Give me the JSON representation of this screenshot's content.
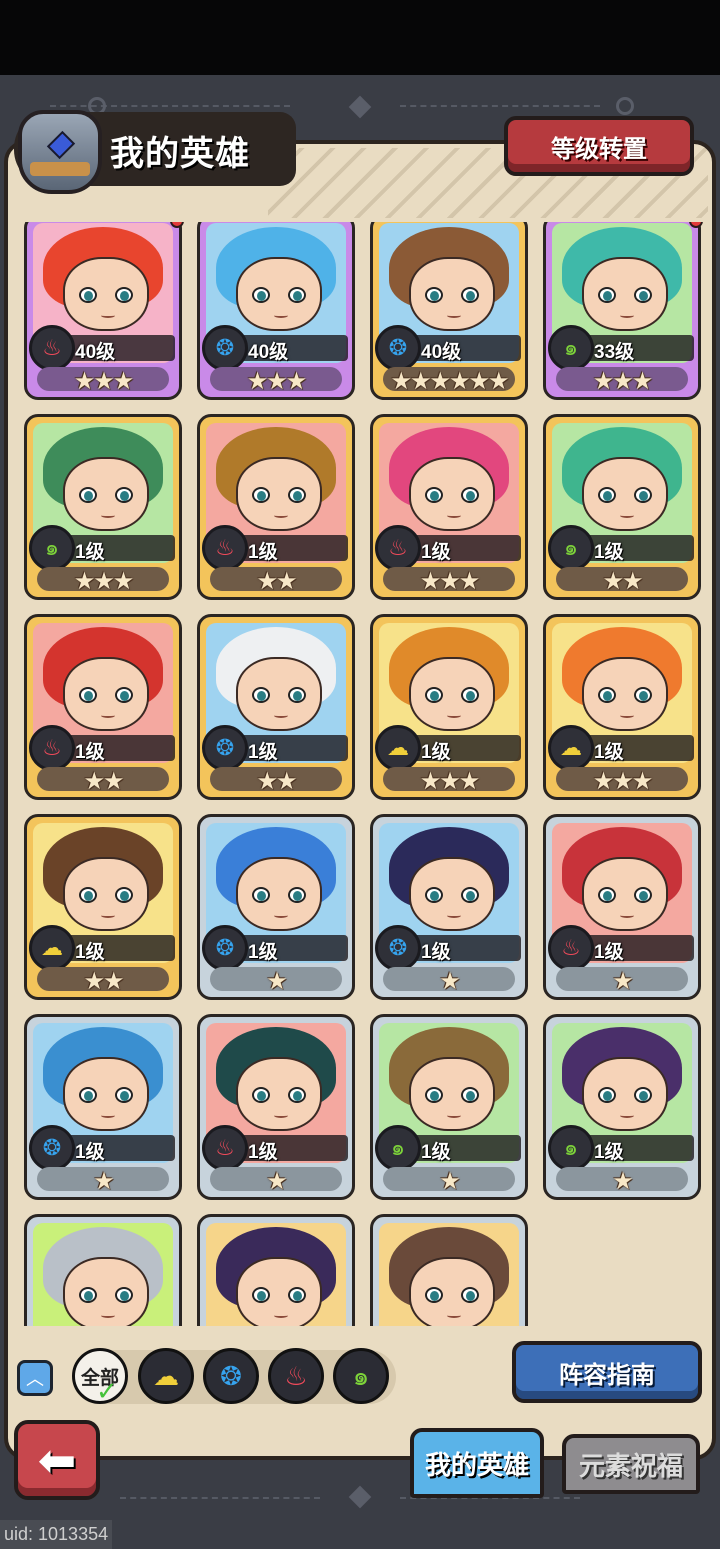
{
  "header": {
    "title": "我的英雄",
    "level_reset_button": "等级转置"
  },
  "heroes": [
    {
      "level": "40级",
      "stars": "★★★",
      "element": "fire",
      "frame": "purple",
      "hair": "#e8452e",
      "bg": "#f6b3c8",
      "badge": true
    },
    {
      "level": "40级",
      "stars": "★★★",
      "element": "water",
      "frame": "purple",
      "hair": "#4fb2e8",
      "bg": "#9fd3f0",
      "badge": false
    },
    {
      "level": "40级",
      "stars": "★★★★★★",
      "element": "water",
      "frame": "gold",
      "hair": "#8b5a36",
      "bg": "#9fd3f0",
      "badge": false
    },
    {
      "level": "33级",
      "stars": "★★★",
      "element": "wind",
      "frame": "purple",
      "hair": "#3fb9a9",
      "bg": "#b6e6a3",
      "badge": true
    },
    {
      "level": "1级",
      "stars": "★★★",
      "element": "wind",
      "frame": "gold",
      "hair": "#3e8c5a",
      "bg": "#b6e6a3",
      "badge": false
    },
    {
      "level": "1级",
      "stars": "★★",
      "element": "fire",
      "frame": "gold",
      "hair": "#b07a2a",
      "bg": "#f4a8a0",
      "badge": false
    },
    {
      "level": "1级",
      "stars": "★★★",
      "element": "fire",
      "frame": "gold",
      "hair": "#e2477e",
      "bg": "#f4a8a0",
      "badge": false
    },
    {
      "level": "1级",
      "stars": "★★",
      "element": "wind",
      "frame": "gold",
      "hair": "#3fb58e",
      "bg": "#b6e6a3",
      "badge": false
    },
    {
      "level": "1级",
      "stars": "★★",
      "element": "fire",
      "frame": "gold",
      "hair": "#d4342e",
      "bg": "#f4a8a0",
      "badge": false
    },
    {
      "level": "1级",
      "stars": "★★",
      "element": "water",
      "frame": "gold",
      "hair": "#eef0f2",
      "bg": "#9fd3f0",
      "badge": false
    },
    {
      "level": "1级",
      "stars": "★★★",
      "element": "earth",
      "frame": "gold",
      "hair": "#e08a2a",
      "bg": "#f7e28a",
      "badge": false
    },
    {
      "level": "1级",
      "stars": "★★★",
      "element": "earth",
      "frame": "gold",
      "hair": "#ef7a2e",
      "bg": "#f7e28a",
      "badge": false
    },
    {
      "level": "1级",
      "stars": "★★",
      "element": "earth",
      "frame": "gold",
      "hair": "#6a4328",
      "bg": "#f7e28a",
      "badge": false
    },
    {
      "level": "1级",
      "stars": "★",
      "element": "water",
      "frame": "silver",
      "hair": "#3a7fd8",
      "bg": "#9fd3f0",
      "badge": false
    },
    {
      "level": "1级",
      "stars": "★",
      "element": "water",
      "frame": "silver",
      "hair": "#2b2a5a",
      "bg": "#9fd3f0",
      "badge": false
    },
    {
      "level": "1级",
      "stars": "★",
      "element": "fire",
      "frame": "silver",
      "hair": "#c8333a",
      "bg": "#f4a8a0",
      "badge": false
    },
    {
      "level": "1级",
      "stars": "★",
      "element": "water",
      "frame": "silver",
      "hair": "#3a8fd0",
      "bg": "#9fd3f0",
      "badge": false
    },
    {
      "level": "1级",
      "stars": "★",
      "element": "fire",
      "frame": "silver",
      "hair": "#1f4a4a",
      "bg": "#f4a8a0",
      "badge": false
    },
    {
      "level": "1级",
      "stars": "★",
      "element": "wind",
      "frame": "silver",
      "hair": "#8a6a3a",
      "bg": "#b6e6a3",
      "badge": false
    },
    {
      "level": "1级",
      "stars": "★",
      "element": "wind",
      "frame": "silver",
      "hair": "#4a2f6a",
      "bg": "#b6e6a3",
      "badge": false
    },
    {
      "level": "",
      "stars": "",
      "element": "none",
      "frame": "silver",
      "hair": "#b9c0c8",
      "bg": "#c9f07a",
      "badge": false
    },
    {
      "level": "",
      "stars": "",
      "element": "none",
      "frame": "silver",
      "hair": "#3a2a5a",
      "bg": "#f6d58a",
      "badge": false
    },
    {
      "level": "",
      "stars": "",
      "element": "none",
      "frame": "silver",
      "hair": "#6a4a3a",
      "bg": "#f6d58a",
      "badge": false
    }
  ],
  "element_icons": {
    "fire": "♨",
    "water": "❂",
    "wind": "๑",
    "earth": "☁"
  },
  "filter": {
    "all_label": "全部",
    "elements": [
      "earth",
      "water",
      "fire",
      "wind"
    ]
  },
  "guide_button": "阵容指南",
  "tabs": {
    "my_heroes": "我的英雄",
    "element_blessing": "元素祝福"
  },
  "back_icon": "back-arrow-icon",
  "uid": "uid: 1013354"
}
